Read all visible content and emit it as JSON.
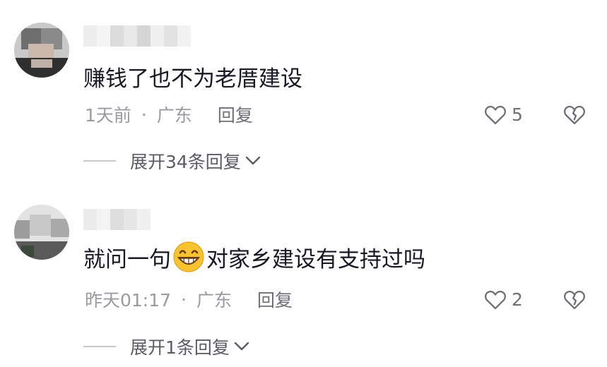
{
  "comments": [
    {
      "text": "赚钱了也不为老厝建设",
      "time": "1天前",
      "separator": "·",
      "location": "广东",
      "reply_label": "回复",
      "like_count": "5",
      "expand_label": "展开34条回复"
    },
    {
      "text_before": "就问一句",
      "emoji": "grinning-face-emoji",
      "text_after": "对家乡建设有支持过吗",
      "time": "昨天01:17",
      "separator": "·",
      "location": "广东",
      "reply_label": "回复",
      "like_count": "2",
      "expand_label": "展开1条回复"
    }
  ],
  "colors": {
    "text": "#161823",
    "meta": "#9a9aa0",
    "secondary": "#6f6f76",
    "emoji_yellow": "#f7c331"
  },
  "icons": [
    "heart-outline-icon",
    "broken-heart-icon",
    "chevron-down-icon"
  ]
}
